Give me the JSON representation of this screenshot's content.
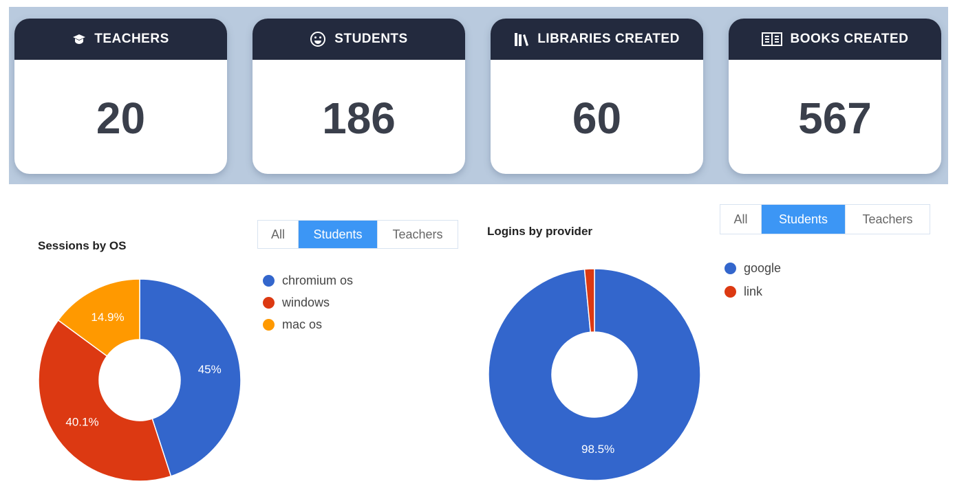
{
  "stats": [
    {
      "label": "TEACHERS",
      "value": "20",
      "icon": "graduation-cap-icon"
    },
    {
      "label": "STUDENTS",
      "value": "186",
      "icon": "smiley-icon"
    },
    {
      "label": "LIBRARIES CREATED",
      "value": "60",
      "icon": "books-icon"
    },
    {
      "label": "BOOKS CREATED",
      "value": "567",
      "icon": "open-book-icon"
    }
  ],
  "filters": {
    "all": "All",
    "students": "Students",
    "teachers": "Teachers",
    "selected": "Students"
  },
  "chart_data": [
    {
      "type": "pie",
      "title": "Sessions by OS",
      "donut": true,
      "legend": "right",
      "categories": [
        "chromium os",
        "windows",
        "mac os"
      ],
      "values": [
        45,
        40.1,
        14.9
      ],
      "labels": [
        "45%",
        "40.1%",
        "14.9%"
      ],
      "colors": [
        "#3366cc",
        "#dc3912",
        "#ff9900"
      ]
    },
    {
      "type": "pie",
      "title": "Logins by provider",
      "donut": true,
      "legend": "right",
      "categories": [
        "google",
        "link"
      ],
      "values": [
        98.5,
        1.5
      ],
      "labels": [
        "98.5%",
        ""
      ],
      "colors": [
        "#3366cc",
        "#dc3912"
      ]
    }
  ]
}
